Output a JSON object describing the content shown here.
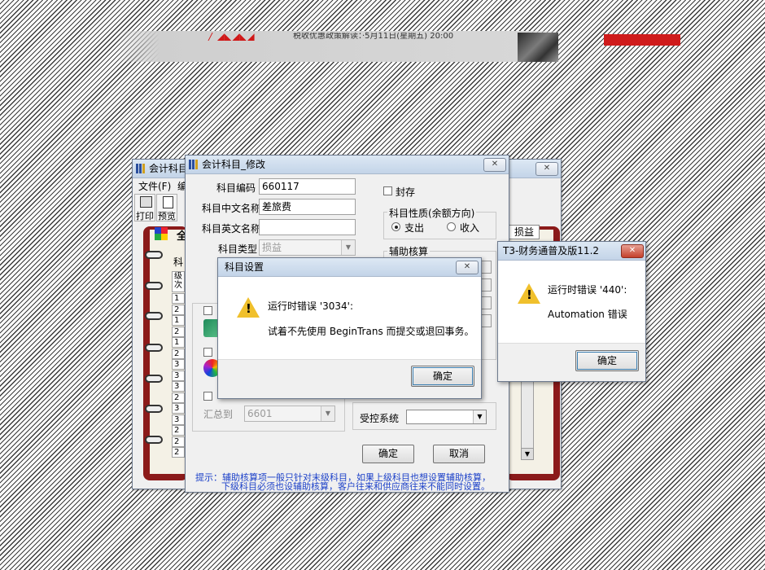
{
  "banner": {
    "text": "税收优惠政策解读：·5月11日(星期五) 20:00",
    "colors": {
      "brand_red": "#d01818",
      "banner_gray": "#c9c9c9"
    }
  },
  "bg_window": {
    "title": "会计科目",
    "menu": {
      "file": "文件(F)",
      "edit": "编"
    },
    "toolbar": {
      "print": "打印",
      "preview": "预览"
    },
    "panel_label": "全",
    "sub_label": "科",
    "level_header": "级次",
    "levels": [
      "1",
      "2",
      "1",
      "2",
      "1",
      "2",
      "3",
      "3",
      "3",
      "2",
      "3",
      "3",
      "2",
      "2",
      "2"
    ],
    "tab_label": "损益"
  },
  "edit_dialog": {
    "title": "会计科目_修改",
    "code_label": "科目编码",
    "code_value": "660117",
    "cn_name_label": "科目中文名称",
    "cn_name_value": "差旅费",
    "en_name_label": "科目英文名称",
    "en_name_value": "",
    "type_label": "科目类型",
    "type_value": "损益",
    "seal_label": "封存",
    "nature_group_title": "科目性质(余额方向)",
    "nature_debit": "支出",
    "nature_credit": "收入",
    "aux_group_title": "辅助核算",
    "summary_label": "汇总到",
    "summary_value": "6601",
    "ctrl_system_label": "受控系统",
    "ok_label": "确定",
    "cancel_label": "取消",
    "tip_line1": "提示：辅助核算项一般只针对末级科目，如果上级科目也想设置辅助核算，",
    "tip_line2": "下级科目必须也设辅助核算，客户往来和供应商往来不能同时设置。"
  },
  "error_dialog_1": {
    "title": "科目设置",
    "line1": "运行时错误 '3034':",
    "line2": "试着不先使用 BeginTrans 而提交或退回事务。",
    "ok_label": "确定"
  },
  "error_dialog_2": {
    "title": "T3-财务通普及版11.2",
    "line1": "运行时错误 '440':",
    "line2": "Automation 错误",
    "ok_label": "确定"
  }
}
